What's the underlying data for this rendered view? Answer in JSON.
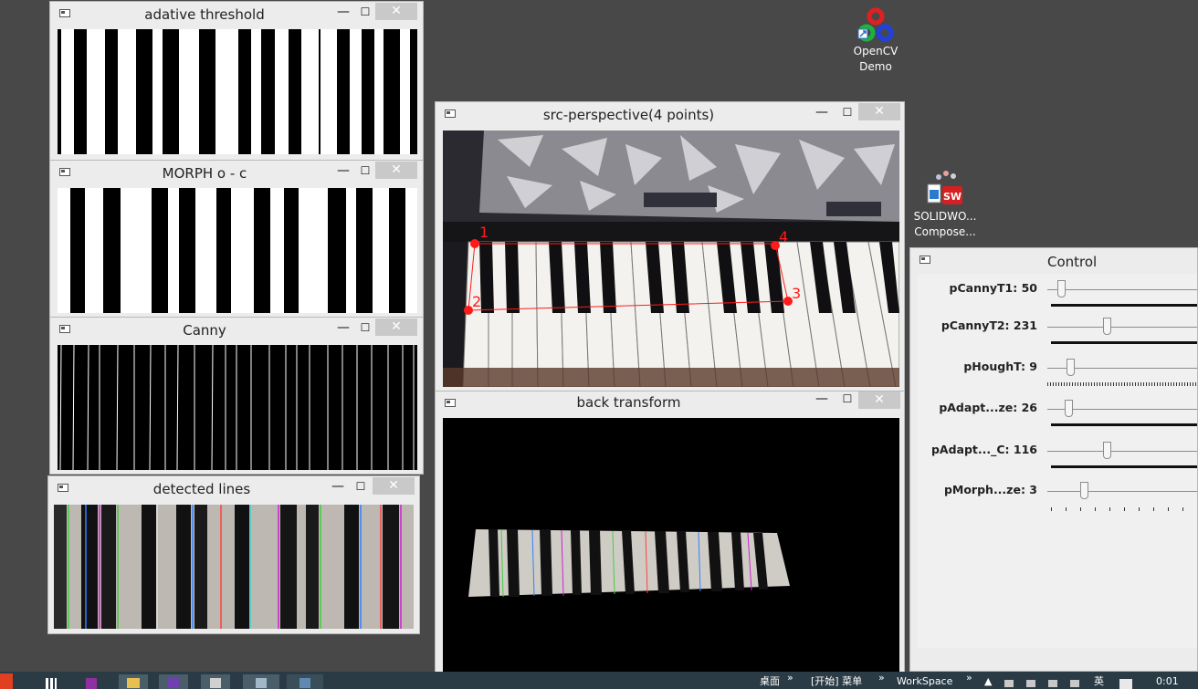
{
  "desktop": {
    "icons": [
      {
        "name": "OpenCV",
        "line2": "Demo"
      },
      {
        "name": "SOLIDWO...",
        "line2": "Compose..."
      }
    ]
  },
  "window_buttons": {
    "minimize": "—",
    "maximize": "☐",
    "close": "✕"
  },
  "windows": {
    "adaptive": {
      "title": "adative threshold"
    },
    "morph": {
      "title": "MORPH o - c"
    },
    "canny": {
      "title": "Canny"
    },
    "lines": {
      "title": "detected lines"
    },
    "src": {
      "title": "src-perspective(4 points)",
      "point_labels": [
        "1",
        "2",
        "3",
        "4"
      ]
    },
    "back": {
      "title": "back transform"
    },
    "control": {
      "title": "Control"
    }
  },
  "sliders": [
    {
      "label": "pCannyT1: 50",
      "value": 50
    },
    {
      "label": "pCannyT2: 231",
      "value": 231
    },
    {
      "label": "pHoughT: 9",
      "value": 9
    },
    {
      "label": "pAdapt...ze: 26",
      "value": 26
    },
    {
      "label": "pAdapt..._C: 116",
      "value": 116
    },
    {
      "label": "pMorph...ze: 3",
      "value": 3
    }
  ],
  "taskbar": {
    "desktop_label": "桌面",
    "start_menu": "[开始] 菜单",
    "workspace": "WorkSpace",
    "ime": "英",
    "clock": "0:01",
    "chevron": "»"
  },
  "colors": {
    "accent_red": "#ff1a1a",
    "taskbar": "#2a3b45"
  }
}
